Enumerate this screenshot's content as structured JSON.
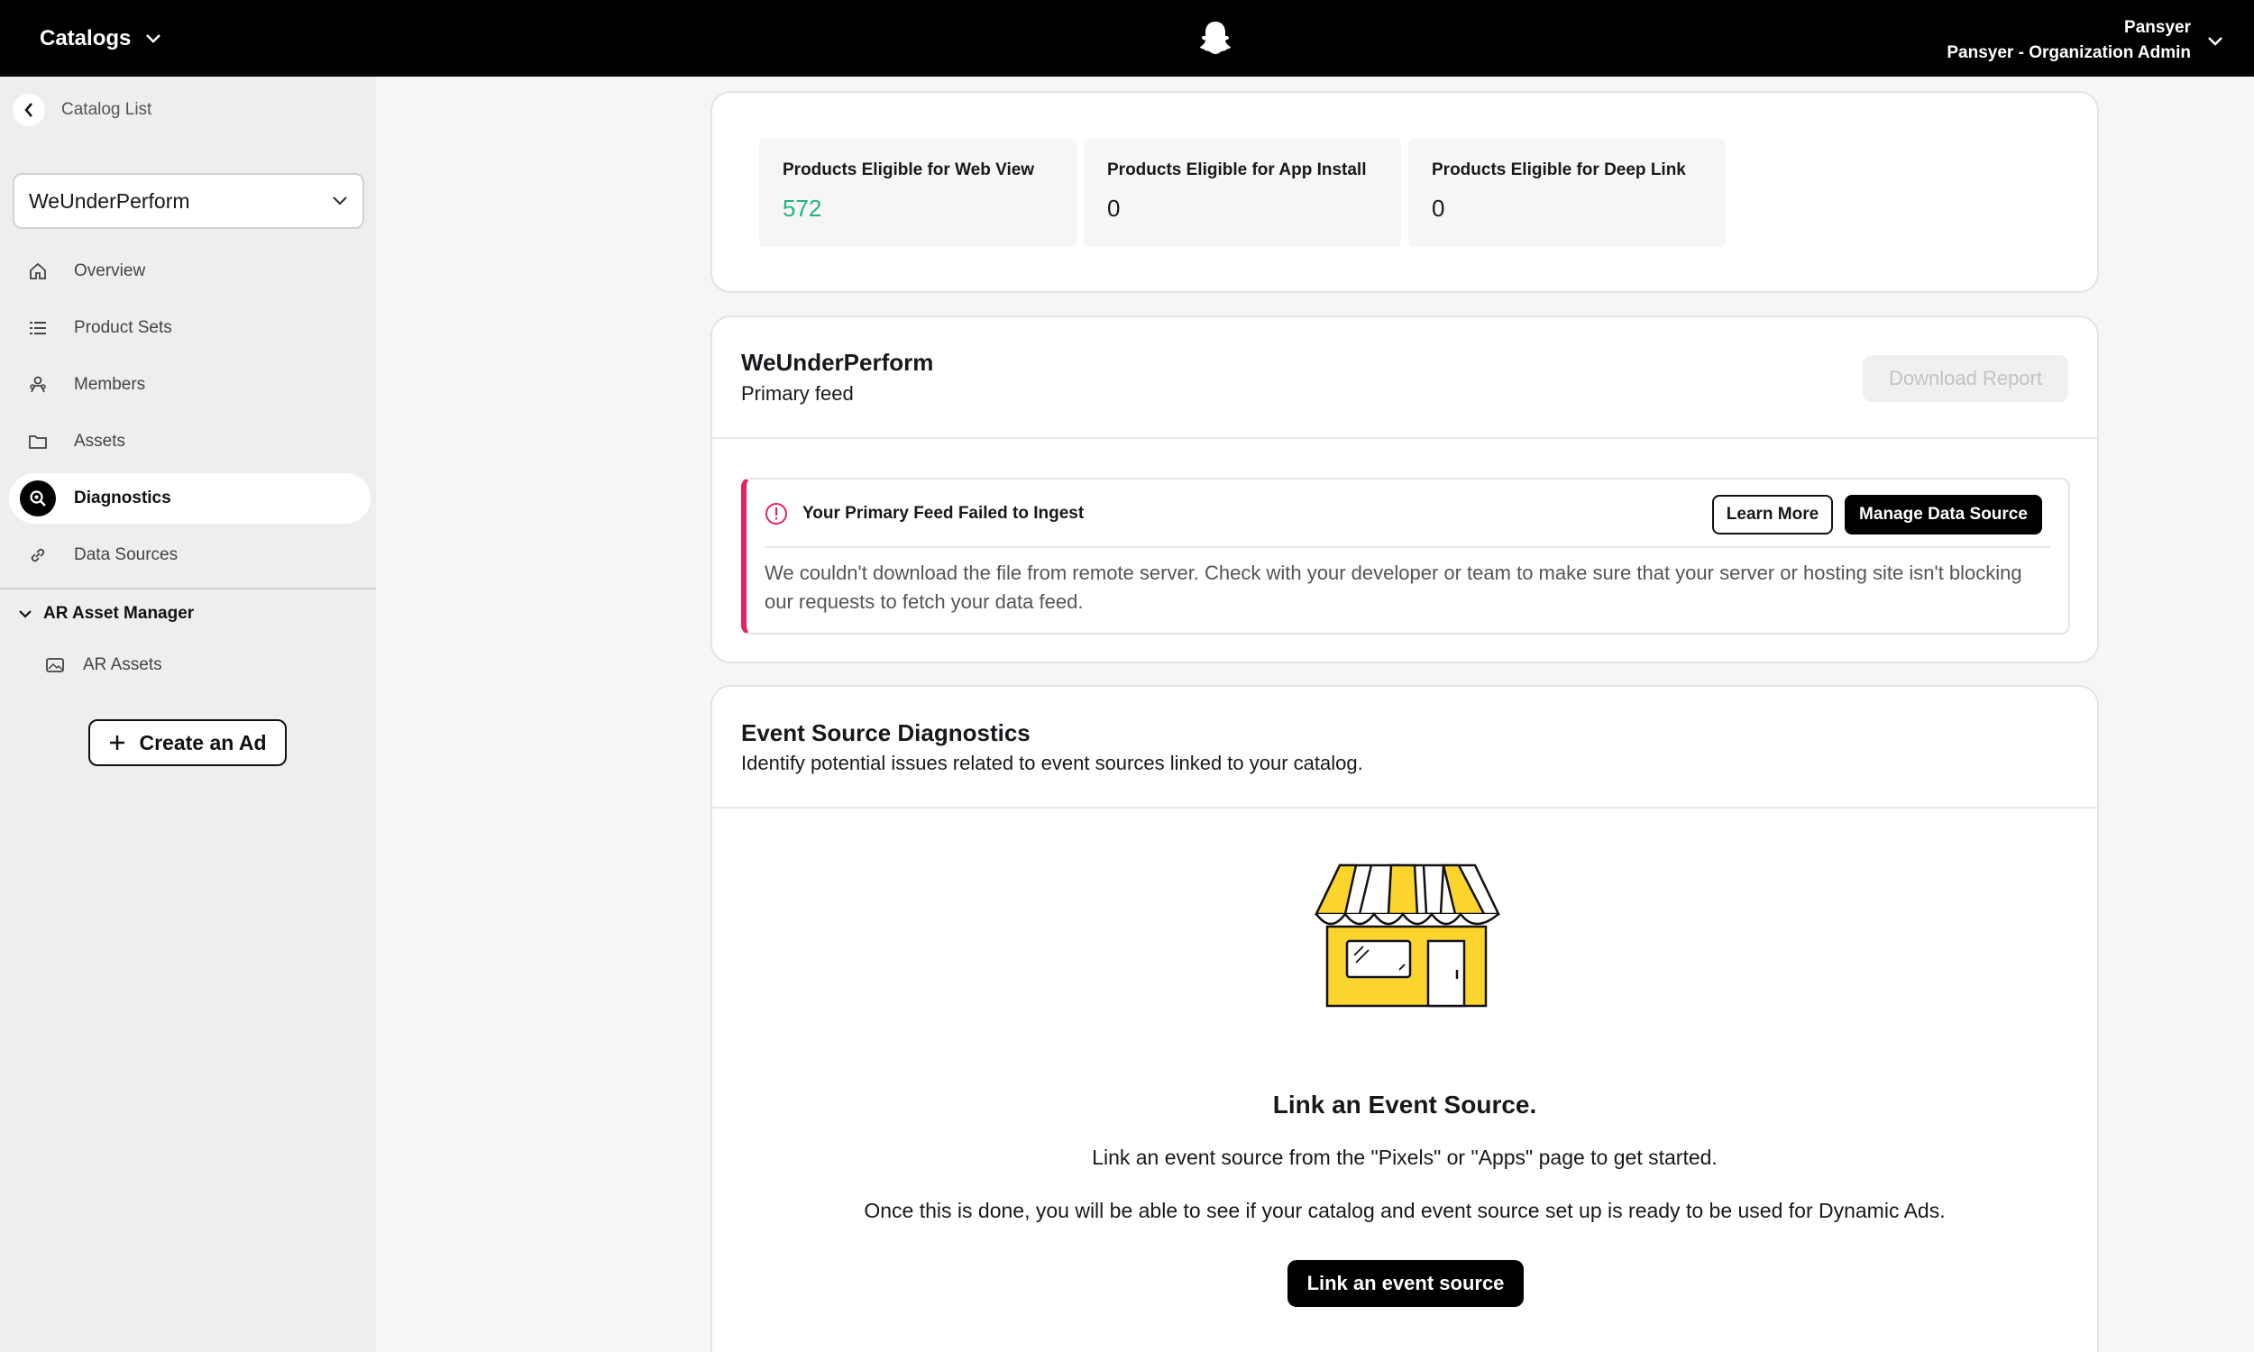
{
  "topbar": {
    "app_name": "Catalogs",
    "account_name": "Pansyer",
    "account_role": "Pansyer - Organization Admin"
  },
  "sidebar": {
    "back_label": "Catalog List",
    "catalog_selected": "WeUnderPerform",
    "items": [
      {
        "label": "Overview",
        "icon": "home-icon"
      },
      {
        "label": "Product Sets",
        "icon": "list-icon"
      },
      {
        "label": "Members",
        "icon": "members-icon"
      },
      {
        "label": "Assets",
        "icon": "folder-icon"
      },
      {
        "label": "Diagnostics",
        "icon": "diagnostics-icon",
        "active": true
      },
      {
        "label": "Data Sources",
        "icon": "link-icon"
      }
    ],
    "group_label": "AR Asset Manager",
    "group_item": "AR Assets",
    "create_ad_label": "Create an Ad"
  },
  "stats": [
    {
      "label": "Products Eligible for Web View",
      "value": "572"
    },
    {
      "label": "Products Eligible for App Install",
      "value": "0"
    },
    {
      "label": "Products Eligible for Deep Link",
      "value": "0"
    }
  ],
  "feed": {
    "title": "WeUnderPerform",
    "subtitle": "Primary feed",
    "download_label": "Download Report",
    "alert": {
      "title": "Your Primary Feed Failed to Ingest",
      "learn_more": "Learn More",
      "manage": "Manage Data Source",
      "body": "We couldn't download the file from remote server. Check with your developer or team to make sure that your server or hosting site isn't blocking our requests to fetch your data feed."
    }
  },
  "events": {
    "title": "Event Source Diagnostics",
    "subtitle": "Identify potential issues related to event sources linked to your catalog.",
    "heading": "Link an Event Source.",
    "p1": "Link an event source from the \"Pixels\" or \"Apps\" page to get started.",
    "p2": "Once this is done, you will be able to see if your catalog and event source set up is ready to be used for Dynamic Ads.",
    "button": "Link an event source"
  },
  "colors": {
    "accent_green": "#21b57e",
    "alert_red": "#e0245e",
    "store_yellow": "#fcd42e"
  }
}
